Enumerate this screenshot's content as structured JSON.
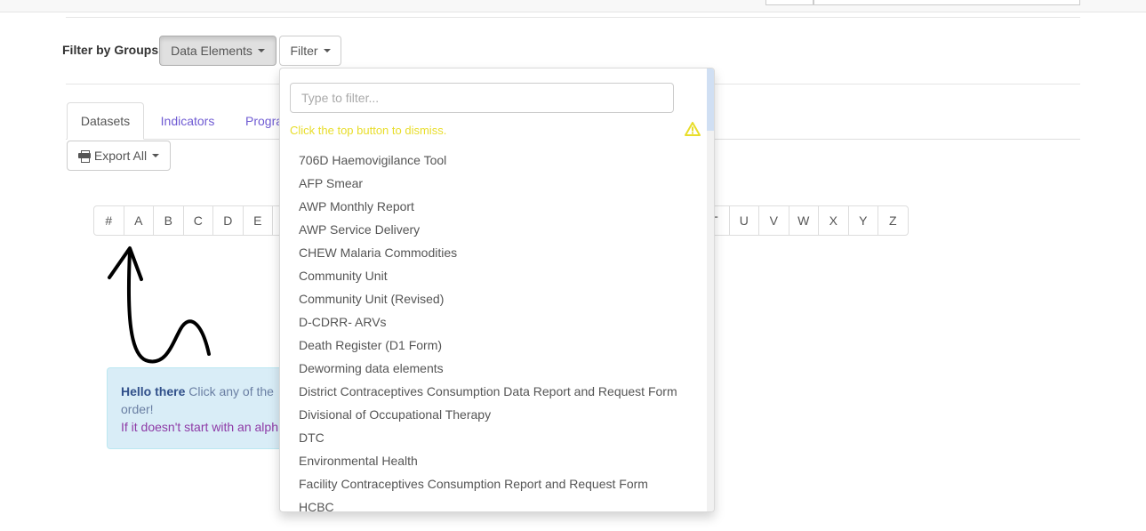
{
  "filter": {
    "label": "Filter by Groups",
    "group_button": "Data Elements",
    "filter_button": "Filter"
  },
  "tabs": [
    {
      "label": "Datasets",
      "active": true
    },
    {
      "label": "Indicators",
      "active": false
    },
    {
      "label": "Progra",
      "active": false
    }
  ],
  "export_button": "Export All",
  "letters_left": [
    "#",
    "A",
    "B",
    "C",
    "D",
    "E"
  ],
  "letters_right": [
    "T",
    "U",
    "V",
    "W",
    "X",
    "Y",
    "Z"
  ],
  "alert": {
    "strong": "Hello there",
    "text1": "Click any of the",
    "text2": "order!",
    "text3": "If it doesn't start with an alph"
  },
  "dropdown": {
    "placeholder": "Type to filter...",
    "hint": "Click the top button to dismiss.",
    "warning_icon": "warning-triangle-icon",
    "items": [
      "706D Haemovigilance Tool",
      "AFP Smear",
      "AWP Monthly Report",
      "AWP Service Delivery",
      "CHEW Malaria Commodities",
      "Community Unit",
      "Community Unit (Revised)",
      "D-CDRR- ARVs",
      "Death Register (D1 Form)",
      "Deworming data elements",
      "District Contraceptives Consumption Data Report and Request Form",
      "Divisional of Occupational Therapy",
      "DTC",
      "Environmental Health",
      "Facility Contraceptives Consumption Report and Request Form",
      "HCBC"
    ]
  },
  "colors": {
    "link": "#6f5bd3",
    "hint": "#e8dd2a",
    "alert_bg": "#d9edf7"
  }
}
